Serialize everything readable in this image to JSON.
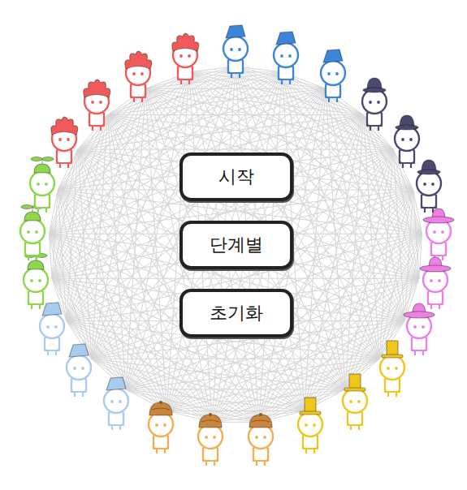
{
  "buttons": [
    {
      "label": "시작"
    },
    {
      "label": "단계별"
    },
    {
      "label": "초기화"
    }
  ],
  "people": [
    {
      "kind": "bucket",
      "color": "#3d85d8"
    },
    {
      "kind": "bucket",
      "color": "#3d85d8"
    },
    {
      "kind": "bucket",
      "color": "#3d85d8"
    },
    {
      "kind": "bowler",
      "color": "#4b4a6e"
    },
    {
      "kind": "bowler",
      "color": "#4b4a6e"
    },
    {
      "kind": "bowler",
      "color": "#4b4a6e"
    },
    {
      "kind": "sunhat",
      "color": "#ee7fe4"
    },
    {
      "kind": "sunhat",
      "color": "#ee7fe4"
    },
    {
      "kind": "sunhat",
      "color": "#ee7fe4"
    },
    {
      "kind": "tophat",
      "color": "#efc71c"
    },
    {
      "kind": "tophat",
      "color": "#efc71c"
    },
    {
      "kind": "tophat",
      "color": "#efc71c"
    },
    {
      "kind": "deerstalker",
      "color": "#f4ad52"
    },
    {
      "kind": "deerstalker",
      "color": "#f4ad52"
    },
    {
      "kind": "deerstalker",
      "color": "#f4ad52"
    },
    {
      "kind": "pail",
      "color": "#a9cbee"
    },
    {
      "kind": "pail",
      "color": "#a9cbee"
    },
    {
      "kind": "pail",
      "color": "#a9cbee"
    },
    {
      "kind": "propeller",
      "color": "#8fd64c"
    },
    {
      "kind": "propeller",
      "color": "#8fd64c"
    },
    {
      "kind": "propeller",
      "color": "#8fd64c"
    },
    {
      "kind": "jester",
      "color": "#f05a5a"
    },
    {
      "kind": "jester",
      "color": "#f05a5a"
    },
    {
      "kind": "jester",
      "color": "#f05a5a"
    },
    {
      "kind": "jester",
      "color": "#f05a5a"
    }
  ]
}
